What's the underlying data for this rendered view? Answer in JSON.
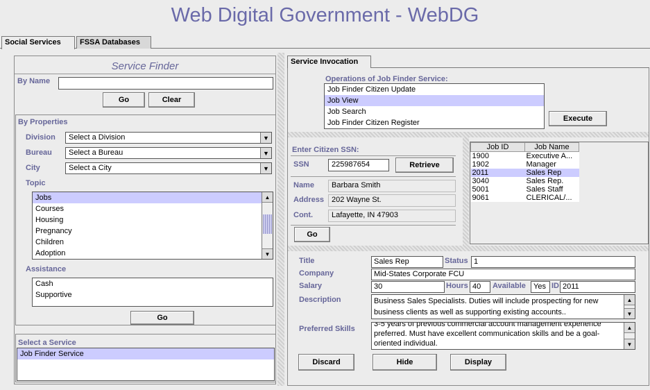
{
  "app_title": "Web Digital Government - WebDG",
  "tabs": [
    "Social Services",
    "FSSA Databases"
  ],
  "finder": {
    "title": "Service Finder",
    "by_name_label": "By Name",
    "by_name_value": "",
    "go_label": "Go",
    "clear_label": "Clear",
    "by_properties_label": "By Properties",
    "division_label": "Division",
    "division_value": "Select a Division",
    "bureau_label": "Bureau",
    "bureau_value": "Select a Bureau",
    "city_label": "City",
    "city_value": "Select a City",
    "topic_label": "Topic",
    "topics": [
      "Jobs",
      "Courses",
      "Housing",
      "Pregnancy",
      "Children",
      "Adoption"
    ],
    "assistance_label": "Assistance",
    "assistance": [
      "Cash",
      "Supportive"
    ],
    "go2_label": "Go",
    "select_service_label": "Select a Service",
    "services": [
      "Job Finder Service"
    ]
  },
  "invocation": {
    "tab_label": "Service Invocation",
    "ops_header": "Operations of Job Finder Service:",
    "operations": [
      "Job Finder Citizen Update",
      "Job View",
      "Job Search",
      "Job Finder Citizen Register"
    ],
    "execute_label": "Execute",
    "enter_ssn_label": "Enter Citizen SSN:",
    "ssn_label": "SSN",
    "ssn_value": "225987654",
    "retrieve_label": "Retrieve",
    "name_label": "Name",
    "name_value": "Barbara Smith",
    "address_label": "Address",
    "address_value": "202 Wayne St.",
    "cont_label": "Cont.",
    "cont_value": "Lafayette, IN 47903",
    "go_label": "Go",
    "jobs_headers": [
      "Job ID",
      "Job Name"
    ],
    "jobs": [
      {
        "id": "1900",
        "name": "Executive A..."
      },
      {
        "id": "1902",
        "name": "Manager"
      },
      {
        "id": "2011",
        "name": "Sales Rep"
      },
      {
        "id": "3040",
        "name": "Sales Rep."
      },
      {
        "id": "5001",
        "name": "Sales Staff"
      },
      {
        "id": "9061",
        "name": "CLERICAL/..."
      }
    ],
    "title_label": "Title",
    "title_value": "Sales Rep",
    "status_label": "Status",
    "status_value": "1",
    "company_label": "Company",
    "company_value": "Mid-States Corporate FCU",
    "salary_label": "Salary",
    "salary_value": "30",
    "hours_label": "Hours",
    "hours_value": "40",
    "available_label": "Available",
    "available_value": "Yes",
    "id_label": "ID",
    "id_value": "2011",
    "description_label": "Description",
    "description_value": "Business Sales Specialists. Duties will include prospecting for new business clients as well as supporting existing accounts..",
    "skills_label": "Preferred Skills",
    "skills_value": "3-5 years of previous commercial account management experience preferred. Must have excellent communication skills and be a goal-oriented individual.",
    "discard_label": "Discard",
    "hide_label": "Hide",
    "display_label": "Display"
  }
}
